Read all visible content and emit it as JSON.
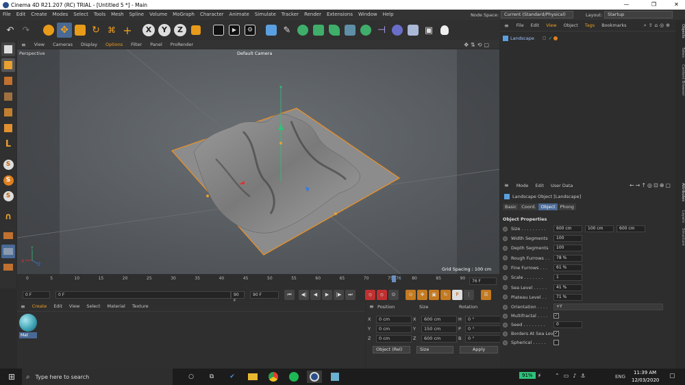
{
  "window": {
    "title": "Cinema 4D R21.207 (RC) TRIAL - [Untitled 5 *] - Main"
  },
  "menu": [
    "File",
    "Edit",
    "Create",
    "Modes",
    "Select",
    "Tools",
    "Mesh",
    "Spline",
    "Volume",
    "MoGraph",
    "Character",
    "Animate",
    "Simulate",
    "Tracker",
    "Render",
    "Extensions",
    "Window",
    "Help"
  ],
  "nodespace": {
    "label": "Node Space:",
    "value": "Current (Standard/Physical)"
  },
  "layout": {
    "label": "Layout:",
    "value": "Startup"
  },
  "toolbar": {
    "axis_x": "X",
    "axis_y": "Y",
    "axis_z": "Z"
  },
  "viewport": {
    "menu": [
      "View",
      "Cameras",
      "Display",
      "Options",
      "Filter",
      "Panel",
      "ProRender"
    ],
    "name": "Perspective",
    "camera": "Default Camera",
    "grid_spacing": "Grid Spacing : 100 cm",
    "axis_y": "Y",
    "axis_x": "X",
    "axis_z": "Z"
  },
  "timeline": {
    "ticks": [
      "0",
      "5",
      "10",
      "15",
      "20",
      "25",
      "30",
      "35",
      "40",
      "45",
      "50",
      "55",
      "60",
      "65",
      "70",
      "75",
      "80",
      "85",
      "90"
    ],
    "current_marker": "76",
    "current_frame": "76 F",
    "start": "0 F",
    "start2": "0 F",
    "end": "90 F",
    "end2": "90 F"
  },
  "material_panel": {
    "menu": [
      "Create",
      "Edit",
      "View",
      "Select",
      "Material",
      "Texture"
    ],
    "material_name": "Mat"
  },
  "coords": {
    "headers": {
      "position": "Position",
      "size": "Size",
      "rotation": "Rotation"
    },
    "rows": [
      {
        "axis": "X",
        "pos": "0 cm",
        "saxis": "X",
        "size": "600 cm",
        "raxis": "H",
        "rot": "0 °"
      },
      {
        "axis": "Y",
        "pos": "0 cm",
        "saxis": "Y",
        "size": "150 cm",
        "raxis": "P",
        "rot": "0 °"
      },
      {
        "axis": "Z",
        "pos": "0 cm",
        "saxis": "Z",
        "size": "600 cm",
        "raxis": "B",
        "rot": "0 °"
      }
    ],
    "mode": "Object (Rel)",
    "size_mode": "Size",
    "apply": "Apply"
  },
  "object_manager": {
    "menu": [
      "File",
      "Edit",
      "View",
      "Object",
      "Tags",
      "Bookmarks"
    ],
    "items": [
      {
        "name": "Landscape"
      }
    ]
  },
  "attributes": {
    "menu": [
      "Mode",
      "Edit",
      "User Data"
    ],
    "title": "Landscape Object [Landscape]",
    "tabs": [
      "Basic",
      "Coord.",
      "Object",
      "Phong"
    ],
    "active_tab": "Object",
    "section": "Object Properties",
    "size": {
      "label": "Size . . . . . . . . .",
      "x": "600 cm",
      "y": "100 cm",
      "z": "600 cm"
    },
    "props": [
      {
        "label": "Width Segments",
        "value": "100"
      },
      {
        "label": "Depth Segments",
        "value": "100"
      },
      {
        "label": "Rough Furrows . .",
        "value": "78 %"
      },
      {
        "label": "Fine Furrows . . .",
        "value": "61 %"
      },
      {
        "label": "Scale . . . . . . .",
        "value": "1"
      },
      {
        "label": "Sea Level . . . . .",
        "value": "41 %"
      },
      {
        "label": "Plateau Level . .",
        "value": "71 %"
      }
    ],
    "orientation": {
      "label": "Orientation . . . .",
      "value": "+Y"
    },
    "multifractal": {
      "label": "Multifractal . . . .",
      "checked": "✓"
    },
    "seed": {
      "label": "Seed . . . . . . . .",
      "value": "0"
    },
    "borders": {
      "label": "Borders At Sea Level",
      "checked": "✓"
    },
    "spherical": {
      "label": "Spherical . . . . .",
      "checked": ""
    }
  },
  "right_tabs": [
    "Objects",
    "Takes",
    "Content Browser",
    "Attributes",
    "Layers",
    "Structure"
  ],
  "taskbar": {
    "search_placeholder": "Type here to search",
    "battery": "91%",
    "lang": "ENG",
    "time": "11:39 AM",
    "date": "12/03/2020"
  }
}
